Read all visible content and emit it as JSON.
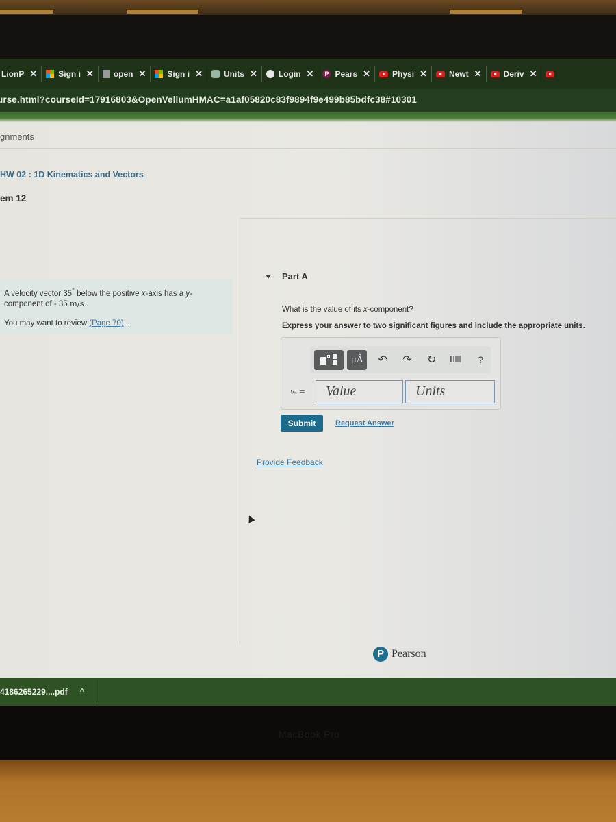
{
  "browser": {
    "tabs": [
      {
        "icon": "lionpath-icon",
        "label": "LionP"
      },
      {
        "icon": "microsoft-icon",
        "label": "Sign i"
      },
      {
        "icon": "document-icon",
        "label": "open"
      },
      {
        "icon": "microsoft-icon",
        "label": "Sign i"
      },
      {
        "icon": "units-icon",
        "label": "Units"
      },
      {
        "icon": "globe-icon",
        "label": "Login"
      },
      {
        "icon": "pearson-icon",
        "label": "Pears"
      },
      {
        "icon": "youtube-icon",
        "label": "Physi"
      },
      {
        "icon": "youtube-icon",
        "label": "Newt"
      },
      {
        "icon": "youtube-icon",
        "label": "Deriv"
      }
    ],
    "close_glyph": "✕",
    "address": "urse.html?courseId=17916803&OpenVellumHMAC=a1af05820c83f9894f9e499b85bdfc38#10301"
  },
  "page": {
    "breadcrumb": "gnments",
    "assignment_title": "HW 02 : 1D Kinematics and Vectors",
    "problem_label": "em 12",
    "prompt": {
      "line1_pre": "A velocity vector 35",
      "degree": "°",
      "line1_mid": " below the positive ",
      "x_axis": "x",
      "line1_mid2": "-axis has a ",
      "y": "y",
      "line1_post": "-component of - 35 ",
      "unit": "m/s",
      "period": " .",
      "review_pre": "You may want to review ",
      "review_link": "(Page 70)",
      "review_post": " ."
    },
    "part": {
      "label": "Part A",
      "question_pre": "What is the value of its ",
      "question_var": "x",
      "question_post": "-component?",
      "instruction": "Express your answer to two significant figures and include the appropriate units."
    },
    "answer": {
      "toolbar": {
        "units_button": "μÅ",
        "undo": "↶",
        "redo": "↷",
        "reset": "↻",
        "help": "?"
      },
      "variable_label": "vₓ =",
      "value_placeholder": "Value",
      "units_placeholder": "Units"
    },
    "submit_label": "Submit",
    "request_answer_label": "Request Answer",
    "provide_feedback_label": "Provide Feedback",
    "footer_brand": "Pearson",
    "footer_logo_letter": "P"
  },
  "downloads": {
    "file_name": "4186265229....pdf",
    "chevron": "^"
  },
  "device": {
    "label": "MacBook Pro"
  },
  "colors": {
    "accent_blue": "#1d6c8e",
    "link_blue": "#3a7aa8",
    "chrome_green": "#2f5224"
  }
}
